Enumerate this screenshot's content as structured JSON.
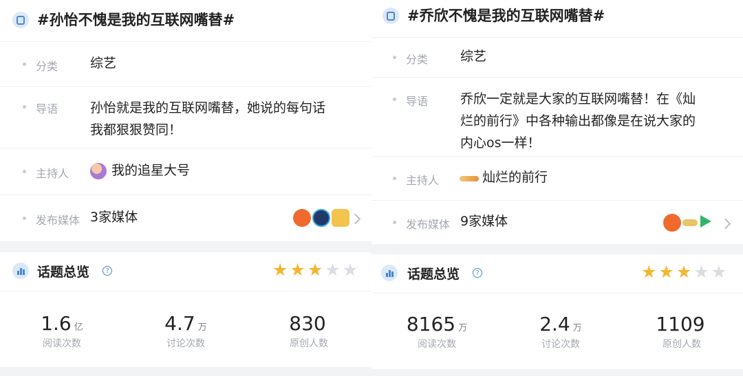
{
  "left": {
    "topic": "#孙怡不愧是我的互联网嘴替#",
    "category_label": "分类",
    "category": "综艺",
    "intro_label": "导语",
    "intro_lines": [
      "孙怡就是我的互联网嘴替，她说的每句话",
      "我都狠狠赞同！"
    ],
    "host_label": "主持人",
    "host": "我的追星大号",
    "media_label": "发布媒体",
    "media": "3家媒体",
    "media_icons": [
      "orange-media-logo",
      "navy-media-logo",
      "megaphone-media-logo"
    ],
    "overview_title": "话题总览",
    "rating": 3,
    "stats": [
      {
        "value": "1.6",
        "unit": "亿",
        "caption": "阅读次数"
      },
      {
        "value": "4.7",
        "unit": "万",
        "caption": "讨论次数"
      },
      {
        "value": "830",
        "unit": "",
        "caption": "原创人数"
      }
    ]
  },
  "right": {
    "topic": "#乔欣不愧是我的互联网嘴替#",
    "category_label": "分类",
    "category": "综艺",
    "intro_label": "导语",
    "intro_lines": [
      "乔欣一定就是大家的互联网嘴替！在《灿",
      "烂的前行》中各种输出都像是在说大家的",
      "内心os一样！"
    ],
    "host_label": "主持人",
    "host": "灿烂的前行",
    "media_label": "发布媒体",
    "media": "9家媒体",
    "media_icons": [
      "orange-media-logo",
      "bird-media-logo",
      "play-media-logo"
    ],
    "overview_title": "话题总览",
    "rating": 3,
    "stats": [
      {
        "value": "8165",
        "unit": "万",
        "caption": "阅读次数"
      },
      {
        "value": "2.4",
        "unit": "万",
        "caption": "讨论次数"
      },
      {
        "value": "1109",
        "unit": "",
        "caption": "原创人数"
      }
    ]
  },
  "colors": {
    "accent": "#4a86d0",
    "star_on": "#f5b52e",
    "star_off": "#d9dce1"
  }
}
